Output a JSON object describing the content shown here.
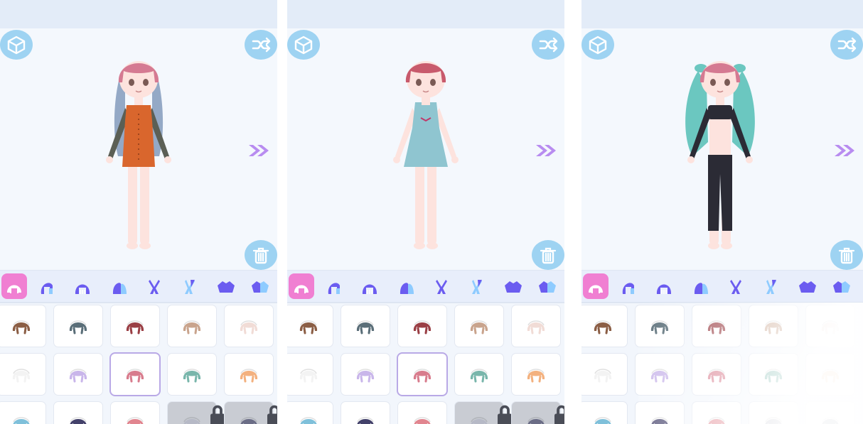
{
  "icons": {
    "top_left": "cube-icon",
    "top_right": "shuffle-icon",
    "bottom_right": "trash-icon",
    "next": "double-chevron-right-icon",
    "lock": "lock-icon"
  },
  "colors": {
    "accent": "#f07fd2",
    "button": "#9ed3f2",
    "tab_icon": "#6b5cf0",
    "arrow": "#b88cf0",
    "selected_border": "#b9a9e6"
  },
  "tabs": [
    "hair-front-tab",
    "hair-back-tab",
    "hair-side-tab",
    "hair-bang-tab",
    "ears-tab",
    "ears-alt-tab",
    "top-tab",
    "top-alt-tab"
  ],
  "panels": [
    {
      "character": {
        "hair": "#d57a92",
        "hair_back": "#8aa0c0",
        "outfit": "#d9662d",
        "sleeves": "#5b5f55",
        "skin": "#fde3de"
      },
      "hair_colors": [
        [
          "#8b5e45",
          "#5a6e78",
          "#9a3f45",
          "#c9a48d",
          "#f1dcd6"
        ],
        [
          "#f3f3f3",
          "#c9b6ea",
          "#d87c8d",
          "#79b6ab",
          "#f3b17f"
        ],
        [
          "#7fc0da",
          "#43416a",
          "#e1858f",
          "#b6b9c6",
          "#6b6d86"
        ]
      ],
      "selected": [
        1,
        2
      ],
      "locked": [
        [
          2,
          3
        ],
        [
          2,
          4
        ]
      ]
    },
    {
      "character": {
        "hair": "#c85a6c",
        "hair_back": "#c85a6c",
        "outfit": "#8fc5d0",
        "sleeves": "#8fc5d0",
        "skin": "#fde3de"
      },
      "hair_colors": [
        [
          "#8b5e45",
          "#5a6e78",
          "#9a3f45",
          "#c9a48d",
          "#f1dcd6"
        ],
        [
          "#f3f3f3",
          "#c9b6ea",
          "#d87c8d",
          "#79b6ab",
          "#f3b17f"
        ],
        [
          "#7fc0da",
          "#43416a",
          "#e1858f",
          "#b6b9c6",
          "#6b6d86"
        ]
      ],
      "selected": [
        1,
        2
      ],
      "locked": [
        [
          2,
          3
        ],
        [
          2,
          4
        ]
      ]
    },
    {
      "character": {
        "hair": "#d57a92",
        "hair_back": "#6bc7c0",
        "outfit": "#2b2b35",
        "sleeves": "#2b2b35",
        "skin": "#fde3de"
      },
      "hair_colors": [
        [
          "#8b5e45",
          "#5a6e78",
          "#9a3f45",
          "#c9a48d",
          "#f1dcd6"
        ],
        [
          "#f3f3f3",
          "#c9b6ea",
          "#d87c8d",
          "#79b6ab",
          "#f3b17f"
        ],
        [
          "#7fc0da",
          "#43416a",
          "#e1858f",
          "#b6b9c6",
          "#6b6d86"
        ]
      ],
      "selected": null,
      "locked": []
    }
  ]
}
